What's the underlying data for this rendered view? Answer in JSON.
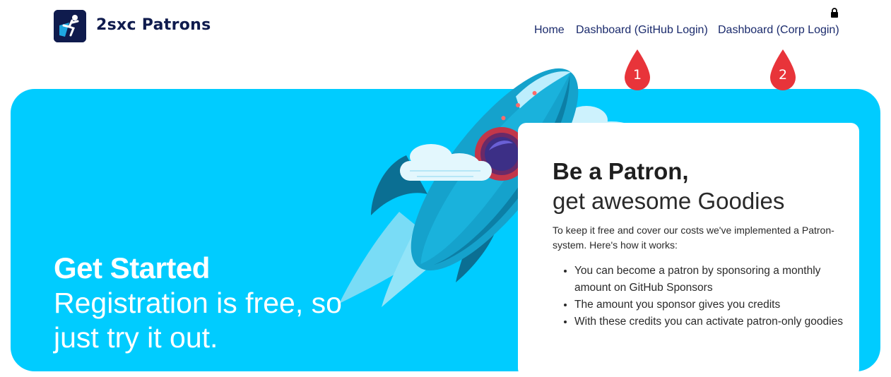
{
  "header": {
    "logo_text": "2sxc Patrons",
    "logo_icon": "rocket-person-logo",
    "lock_icon": "lock-icon"
  },
  "nav": {
    "items": [
      {
        "label": "Home"
      },
      {
        "label": "Dashboard (GitHub Login)"
      },
      {
        "label": "Dashboard (Corp Login)"
      }
    ]
  },
  "annotations": {
    "markers": [
      {
        "label": "1",
        "color": "#e8343a"
      },
      {
        "label": "2",
        "color": "#e8343a"
      }
    ]
  },
  "hero": {
    "background": "#00ccff",
    "title": "Get Started",
    "subtitle": "Registration is free, so just try it out."
  },
  "card": {
    "title": "Be a Patron,",
    "subtitle": "get awesome Goodies",
    "intro": "To keep it free and cover our costs we've implemented a Patron-system. Here's how it works:",
    "bullets": [
      "You can become a patron by sponsoring a monthly amount on GitHub Sponsors",
      "The amount you sponsor gives you credits",
      "With these credits you can activate patron-only goodies"
    ]
  }
}
